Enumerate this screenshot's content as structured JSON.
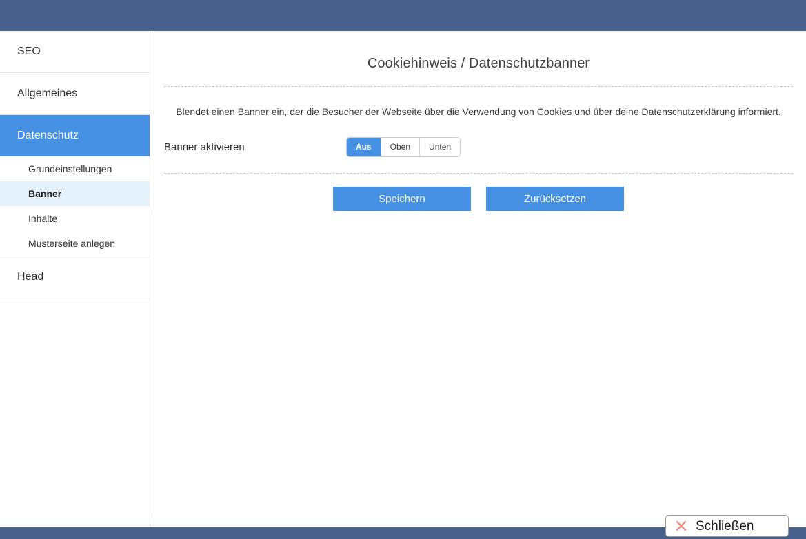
{
  "window": {
    "chrome_color": "#48618c"
  },
  "theme": {
    "accent": "#4590e3",
    "active_sub_bg": "#e5f1fb",
    "close_icon_color": "#f08a76"
  },
  "sidebar": {
    "sections": [
      {
        "label": "SEO",
        "active": false,
        "children": []
      },
      {
        "label": "Allgemeines",
        "active": false,
        "children": []
      },
      {
        "label": "Datenschutz",
        "active": true,
        "children": [
          {
            "label": "Grundeinstellungen",
            "current": false
          },
          {
            "label": "Banner",
            "current": true
          },
          {
            "label": "Inhalte",
            "current": false
          },
          {
            "label": "Musterseite anlegen",
            "current": false
          }
        ]
      },
      {
        "label": "Head",
        "active": false,
        "children": []
      }
    ]
  },
  "main": {
    "title": "Cookiehinweis / Datenschutzbanner",
    "description": "Blendet einen Banner ein, der die Besucher der Webseite über die Verwendung von Cookies und über deine Datenschutzerklärung informiert.",
    "field": {
      "label": "Banner aktivieren",
      "options": [
        {
          "label": "Aus",
          "selected": true
        },
        {
          "label": "Oben",
          "selected": false
        },
        {
          "label": "Unten",
          "selected": false
        }
      ],
      "selected_value": "Aus"
    },
    "buttons": {
      "save": "Speichern",
      "reset": "Zurücksetzen"
    }
  },
  "overlay": {
    "close_button": {
      "label": "Schließen",
      "icon": "close-x-icon"
    }
  }
}
